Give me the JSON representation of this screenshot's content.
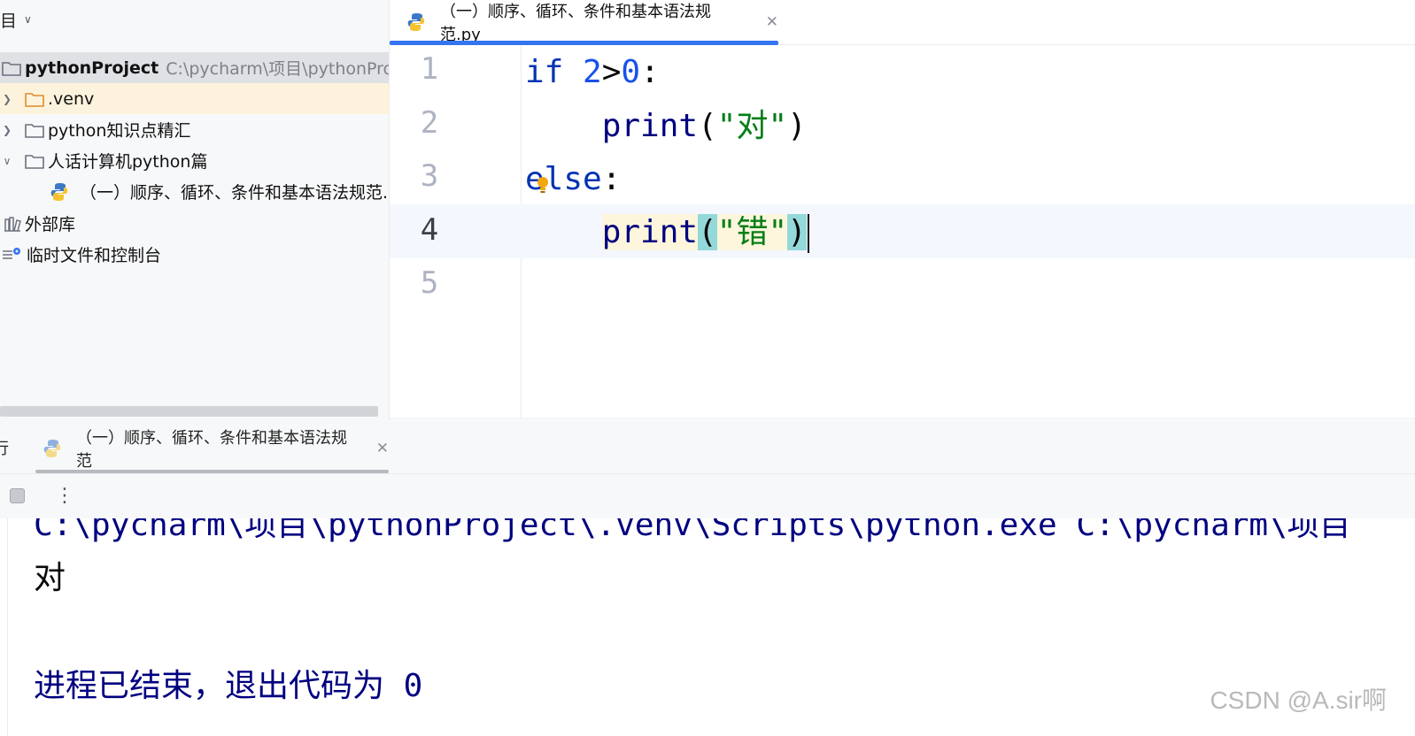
{
  "project_panel": {
    "header_label": "目",
    "tree": [
      {
        "name": "pythonProject",
        "path": "C:\\pycharm\\项目\\pythonProject",
        "icon": "folder-icon",
        "expanded": true
      },
      {
        "name": ".venv",
        "icon": "folder-orange-icon",
        "expanded": false
      },
      {
        "name": "python知识点精汇",
        "icon": "folder-icon",
        "expanded": false
      },
      {
        "name": "人话计算机python篇",
        "icon": "folder-icon",
        "expanded": true
      },
      {
        "name": "（一）顺序、循环、条件和基本语法规范.py",
        "icon": "python-file-icon"
      },
      {
        "name": "外部库",
        "icon": "library-icon"
      },
      {
        "name": "临时文件和控制台",
        "icon": "scratches-icon"
      }
    ]
  },
  "editor": {
    "tab_label": "（一）顺序、循环、条件和基本语法规范.py",
    "line_numbers": [
      "1",
      "2",
      "3",
      "4",
      "5"
    ],
    "current_line": "4",
    "code": {
      "l1_kw": "if",
      "l1_num_a": "2",
      "l1_op": ">",
      "l1_num_b": "0",
      "l1_colon": ":",
      "l2_fn": "print",
      "l2_open": "(",
      "l2_str": "\"对\"",
      "l2_close": ")",
      "l3_kw": "else",
      "l3_colon": ":",
      "l4_fn": "print",
      "l4_open": "(",
      "l4_str": "\"错\"",
      "l4_close": ")"
    }
  },
  "run": {
    "tool_label": "行",
    "tab_label": "（一）顺序、循环、条件和基本语法规范",
    "console_command": "C:\\pycharm\\项目\\pythonProject\\.venv\\Scripts\\python.exe C:\\pycharm\\项目",
    "console_output": "对",
    "console_exit": "进程已结束，退出代码为 0"
  },
  "watermark": "CSDN @A.sir啊",
  "colors": {
    "accent": "#3574f0",
    "keyword": "#0033b3",
    "number": "#1750eb",
    "string": "#067d17",
    "brace_highlight": "#93d9d9"
  }
}
